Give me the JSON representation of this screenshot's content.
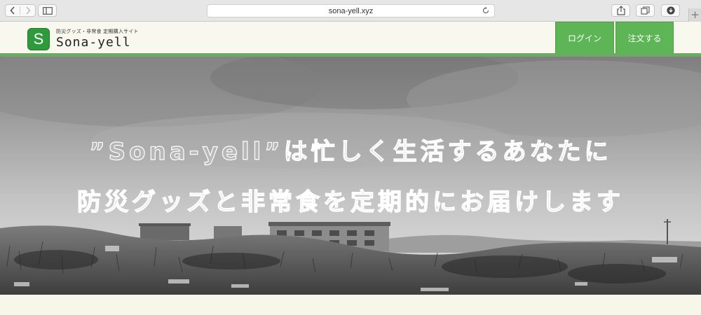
{
  "browser": {
    "url": "sona-yell.xyz",
    "icons": [
      "back-icon",
      "forward-icon",
      "sidebar-icon",
      "reload-icon",
      "share-icon",
      "tabs-icon",
      "download-icon"
    ],
    "new_tab": "+"
  },
  "header": {
    "logo_letter": "S",
    "tagline": "防災グッズ・非常食 定期購入サイト",
    "site_name": "Sona-yell",
    "login_label": "ログイン",
    "order_label": "注文する",
    "accent_color": "#5db555"
  },
  "hero": {
    "line1": "”Sona-yell”は忙しく生活するあなたに",
    "line2": "防災グッズと非常食を定期的にお届けします"
  }
}
